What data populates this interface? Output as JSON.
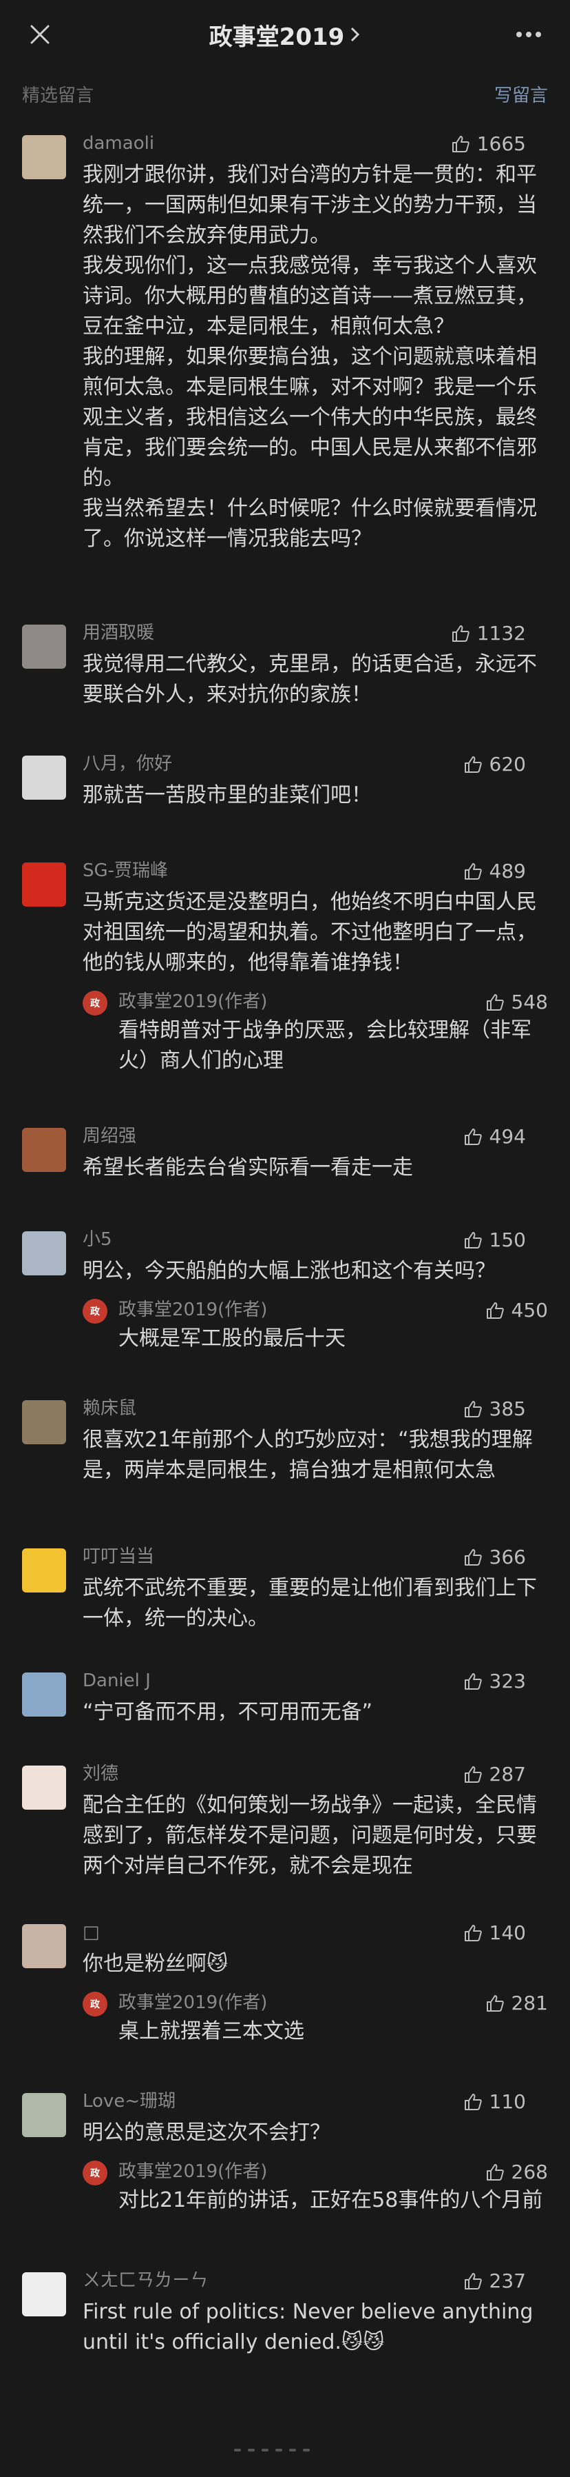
{
  "header": {
    "title": "政事堂2019"
  },
  "subheader": {
    "left": "精选留言",
    "right": "写留言"
  },
  "comments": [
    {
      "name": "damaoli",
      "likes": "1665",
      "avatar_color": "#c8b49a",
      "content": "我刚才跟你讲，我们对台湾的方针是一贯的：和平统一，一国两制但如果有干涉主义的势力干预，当然我们不会放弃使用武力。\n我发现你们，这一点我感觉得，幸亏我这个人喜欢诗词。你大概用的曹植的这首诗——煮豆燃豆萁，豆在釜中泣，本是同根生，相煎何太急？\n我的理解，如果你要搞台独，这个问题就意味着相煎何太急。本是同根生嘛，对不对啊？我是一个乐观主义者，我相信这么一个伟大的中华民族，最终肯定，我们要会统一的。中国人民是从来都不信邪的。\n我当然希望去！什么时候呢？什么时候就要看情况了。你说这样一情况我能去吗？"
    },
    {
      "name": "用酒取暖",
      "likes": "1132",
      "avatar_color": "#8f8a88",
      "content": "我觉得用二代教父，克里昂，的话更合适，永远不要联合外人，来对抗你的家族！"
    },
    {
      "name": "八月，你好",
      "likes": "620",
      "avatar_color": "#d9d9d9",
      "content": "那就苦一苦股市里的韭菜们吧！"
    },
    {
      "name": "SG-贾瑞峰",
      "likes": "489",
      "avatar_color": "#d42a1e",
      "content": "马斯克这货还是没整明白，他始终不明白中国人民对祖国统一的渴望和执着。不过他整明白了一点，他的钱从哪来的，他得靠着谁挣钱！",
      "reply": {
        "name": "政事堂2019(作者)",
        "likes": "548",
        "content": "看特朗普对于战争的厌恶，会比较理解（非军火）商人们的心理"
      }
    },
    {
      "name": "周绍强",
      "likes": "494",
      "avatar_color": "#a05a3a",
      "content": "希望长者能去台省实际看一看走一走"
    },
    {
      "name": "小5",
      "likes": "150",
      "avatar_color": "#a9b7c4",
      "content": "明公，今天船舶的大幅上涨也和这个有关吗？",
      "reply": {
        "name": "政事堂2019(作者)",
        "likes": "450",
        "content": "大概是军工股的最后十天"
      }
    },
    {
      "name": "赖床鼠",
      "likes": "385",
      "avatar_color": "#8c7a5e",
      "content": "很喜欢21年前那个人的巧妙应对：“我想我的理解是，两岸本是同根生，搞台独才是相煎何太急"
    },
    {
      "name": "叮叮当当",
      "likes": "366",
      "avatar_color": "#f2c230",
      "content": "武统不武统不重要，重要的是让他们看到我们上下一体，统一的决心。"
    },
    {
      "name": "Daniel J",
      "likes": "323",
      "avatar_color": "#8aa8c8",
      "content": "“宁可备而不用，不可用而无备”"
    },
    {
      "name": "刘德",
      "likes": "287",
      "avatar_color": "#f0e2d8",
      "content": "配合主任的《如何策划一场战争》一起读，全民情感到了，箭怎样发不是问题，问题是何时发，只要两个对岸自己不作死，就不会是现在"
    },
    {
      "name": "□",
      "likes": "140",
      "avatar_color": "#c9b3a5",
      "content": "你也是粉丝啊😼",
      "reply": {
        "name": "政事堂2019(作者)",
        "likes": "281",
        "content": "桌上就摆着三本文选"
      }
    },
    {
      "name": "Love~珊瑚",
      "likes": "110",
      "avatar_color": "#b0b9a8",
      "content": "明公的意思是这次不会打？",
      "reply": {
        "name": "政事堂2019(作者)",
        "likes": "268",
        "content": "对比21年前的讲话，正好在58事件的八个月前"
      }
    },
    {
      "name": "ㄨㄤㄈㄢㄌㄧㄣ",
      "likes": "237",
      "avatar_color": "#eeeeee",
      "content": "First rule of politics: Never believe anything until it's officially denied.😼😼"
    }
  ]
}
